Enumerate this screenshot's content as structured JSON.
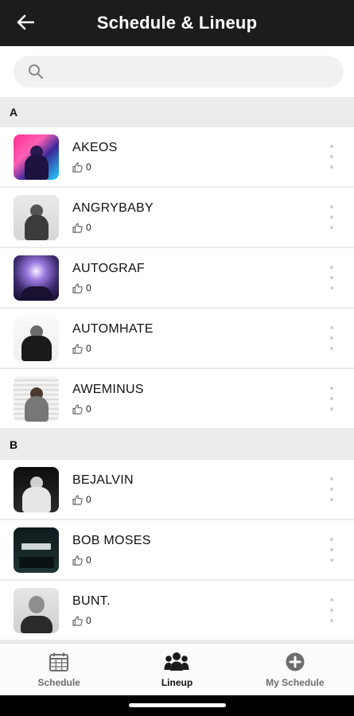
{
  "header": {
    "title": "Schedule & Lineup"
  },
  "search": {
    "placeholder": "",
    "value": ""
  },
  "sections": [
    {
      "letter": "A",
      "artists": [
        {
          "name": "AKEOS",
          "likes": "0"
        },
        {
          "name": "ANGRYBABY",
          "likes": "0"
        },
        {
          "name": "AUTOGRAF",
          "likes": "0"
        },
        {
          "name": "AUTOMHATE",
          "likes": "0"
        },
        {
          "name": "AWEMINUS",
          "likes": "0"
        }
      ]
    },
    {
      "letter": "B",
      "artists": [
        {
          "name": "BEJALVIN",
          "likes": "0"
        },
        {
          "name": "BOB MOSES",
          "likes": "0"
        },
        {
          "name": "BUNT.",
          "likes": "0"
        }
      ]
    }
  ],
  "nav": {
    "items": [
      {
        "label": "Schedule",
        "icon": "calendar-icon",
        "active": false
      },
      {
        "label": "Lineup",
        "icon": "group-icon",
        "active": true
      },
      {
        "label": "My Schedule",
        "icon": "plus-circle-icon",
        "active": false
      }
    ]
  },
  "colors": {
    "header_bg": "#1b1c1e",
    "section_bg": "#ececec",
    "search_bg": "#f1f1f1",
    "active_nav": "#111111",
    "inactive_nav": "#6d6d6d"
  }
}
